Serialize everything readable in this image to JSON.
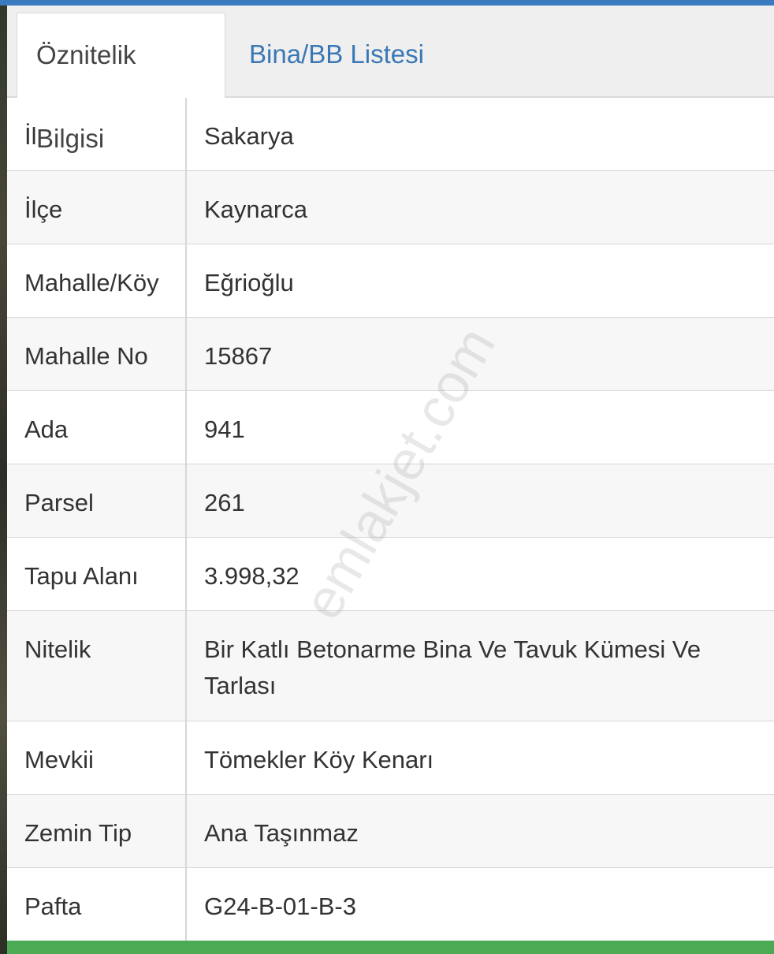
{
  "tabs": [
    {
      "label": "Öznitelik Bilgisi",
      "active": true
    },
    {
      "label": "Bina/BB Listesi",
      "active": false
    }
  ],
  "rows": [
    {
      "key": "İl",
      "value": "Sakarya"
    },
    {
      "key": "İlçe",
      "value": "Kaynarca"
    },
    {
      "key": "Mahalle/Köy",
      "value": "Eğrioğlu"
    },
    {
      "key": "Mahalle No",
      "value": "15867"
    },
    {
      "key": "Ada",
      "value": "941"
    },
    {
      "key": "Parsel",
      "value": "261"
    },
    {
      "key": "Tapu Alanı",
      "value": "3.998,32"
    },
    {
      "key": "Nitelik",
      "value": "Bir Katlı Betonarme Bina Ve Tavuk Kümesi Ve Tarlası"
    },
    {
      "key": "Mevkii",
      "value": "Tömekler Köy Kenarı"
    },
    {
      "key": "Zemin Tip",
      "value": "Ana Taşınmaz"
    },
    {
      "key": "Pafta",
      "value": "G24-B-01-B-3"
    }
  ],
  "watermark": "emlakjet.com",
  "colors": {
    "accent_top": "#3a7bbf",
    "accent_bottom": "#4caa55",
    "link": "#3a78b5"
  }
}
